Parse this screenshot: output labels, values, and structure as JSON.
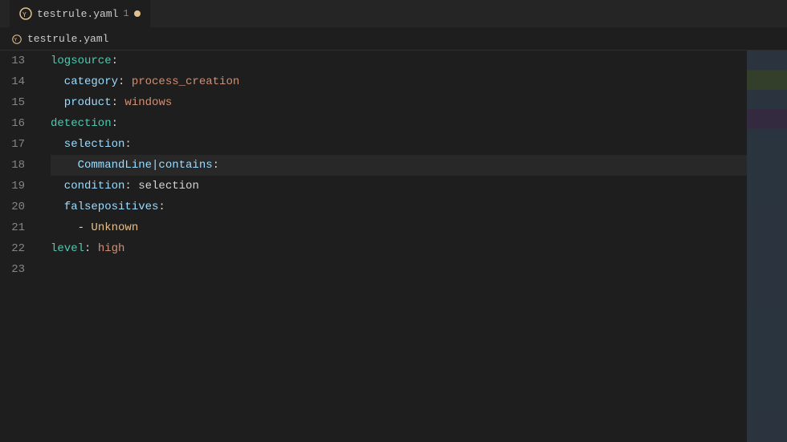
{
  "tab": {
    "label": "testrule.yaml",
    "number": "1",
    "modified": true
  },
  "breadcrumb": {
    "label": "testrule.yaml"
  },
  "lines": [
    {
      "num": 13,
      "indent": 0,
      "tokens": [
        {
          "t": "logsource",
          "c": "key-blue"
        },
        {
          "t": ":",
          "c": "colon"
        }
      ]
    },
    {
      "num": 14,
      "indent": 1,
      "tokens": [
        {
          "t": "  category",
          "c": "key-light-blue"
        },
        {
          "t": ":",
          "c": "colon"
        },
        {
          "t": " process_creation",
          "c": "val-orange"
        }
      ]
    },
    {
      "num": 15,
      "indent": 1,
      "tokens": [
        {
          "t": "  product",
          "c": "key-light-blue"
        },
        {
          "t": ":",
          "c": "colon"
        },
        {
          "t": " windows",
          "c": "val-orange"
        }
      ]
    },
    {
      "num": 16,
      "indent": 0,
      "tokens": [
        {
          "t": "detection",
          "c": "key-blue"
        },
        {
          "t": ":",
          "c": "colon"
        }
      ]
    },
    {
      "num": 17,
      "indent": 1,
      "tokens": [
        {
          "t": "  selection",
          "c": "key-light-blue"
        },
        {
          "t": ":",
          "c": "colon"
        }
      ]
    },
    {
      "num": 18,
      "indent": 2,
      "tokens": [
        {
          "t": "    CommandLine|contains",
          "c": "key-light-blue"
        },
        {
          "t": ":",
          "c": "colon"
        }
      ],
      "active": true
    },
    {
      "num": 19,
      "indent": 1,
      "tokens": [
        {
          "t": "  condition",
          "c": "key-light-blue"
        },
        {
          "t": ":",
          "c": "colon"
        },
        {
          "t": " selection",
          "c": "val-white"
        }
      ]
    },
    {
      "num": 20,
      "indent": 1,
      "tokens": [
        {
          "t": "  falsepositives",
          "c": "key-light-blue"
        },
        {
          "t": ":",
          "c": "colon"
        }
      ]
    },
    {
      "num": 21,
      "indent": 2,
      "tokens": [
        {
          "t": "    - ",
          "c": "dash"
        },
        {
          "t": "Unknown",
          "c": "unknown-val"
        }
      ]
    },
    {
      "num": 22,
      "indent": 0,
      "tokens": [
        {
          "t": "level",
          "c": "key-blue"
        },
        {
          "t": ":",
          "c": "colon"
        },
        {
          "t": " high",
          "c": "high-val"
        }
      ]
    },
    {
      "num": 23,
      "indent": 0,
      "tokens": []
    }
  ]
}
